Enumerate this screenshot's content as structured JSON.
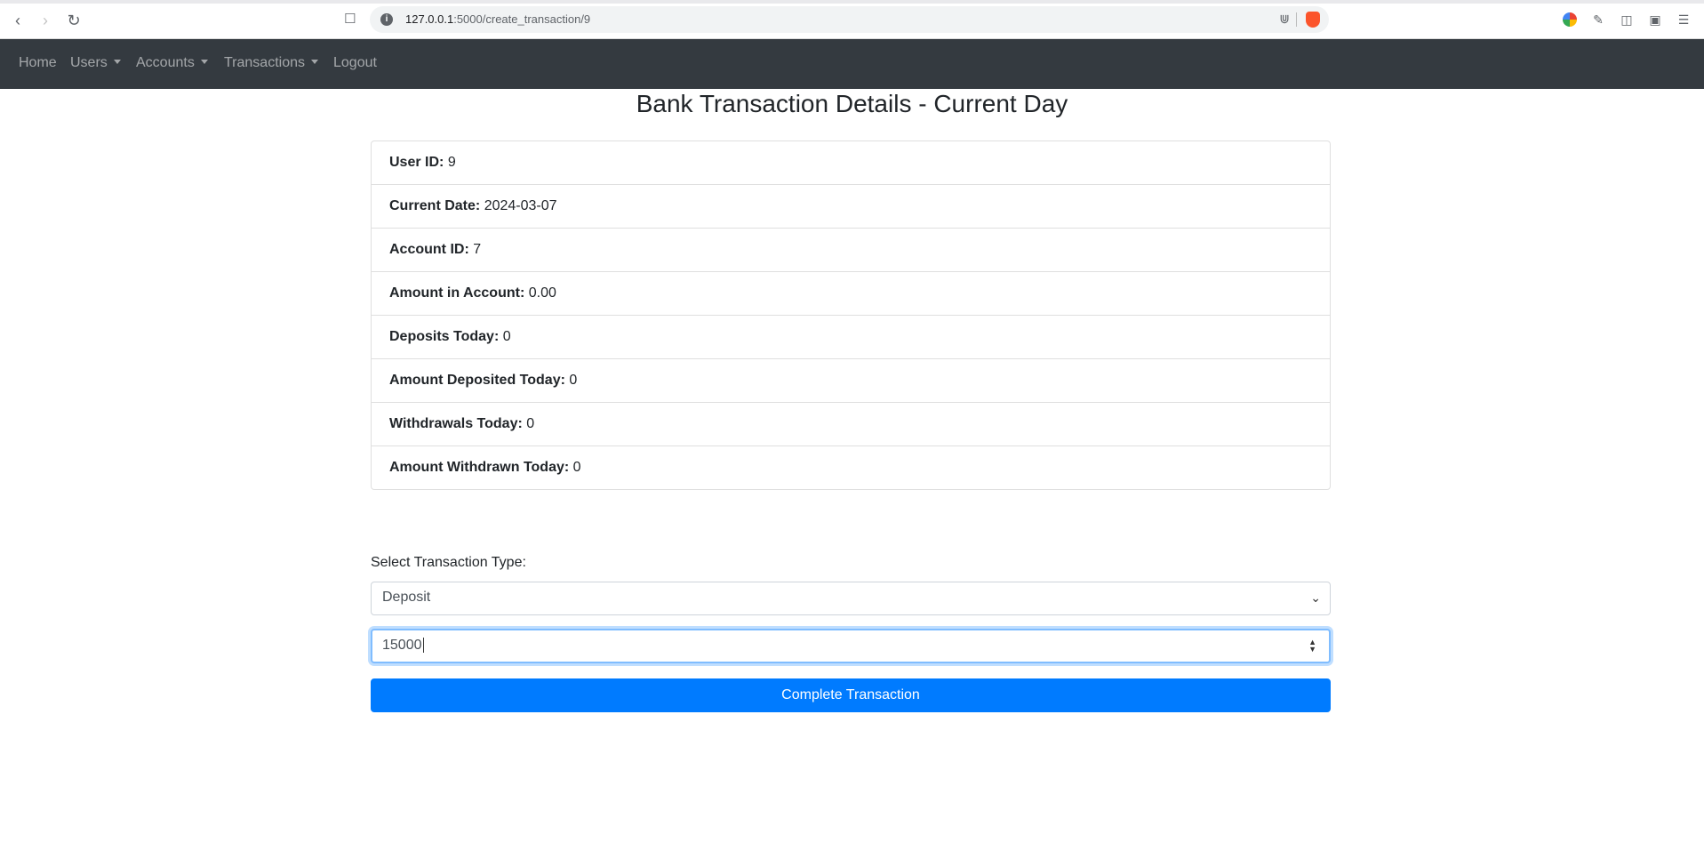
{
  "browser": {
    "url_host": "127.0.0.1",
    "url_rest": ":5000/create_transaction/9"
  },
  "navbar": {
    "items": [
      {
        "label": "Home",
        "dropdown": false
      },
      {
        "label": "Users",
        "dropdown": true
      },
      {
        "label": "Accounts",
        "dropdown": true
      },
      {
        "label": "Transactions",
        "dropdown": true
      },
      {
        "label": "Logout",
        "dropdown": false
      }
    ]
  },
  "page": {
    "title": "Bank Transaction Details - Current Day"
  },
  "details": [
    {
      "label": "User ID:",
      "value": "9"
    },
    {
      "label": "Current Date:",
      "value": "2024-03-07"
    },
    {
      "label": "Account ID:",
      "value": "7"
    },
    {
      "label": "Amount in Account:",
      "value": "0.00"
    },
    {
      "label": "Deposits Today:",
      "value": "0"
    },
    {
      "label": "Amount Deposited Today:",
      "value": "0"
    },
    {
      "label": "Withdrawals Today:",
      "value": "0"
    },
    {
      "label": "Amount Withdrawn Today:",
      "value": "0"
    }
  ],
  "form": {
    "type_label": "Select Transaction Type:",
    "type_selected": "Deposit",
    "amount_value": "15000",
    "submit_label": "Complete Transaction"
  },
  "colors": {
    "navbar": "#343a40",
    "primary": "#007bff"
  }
}
